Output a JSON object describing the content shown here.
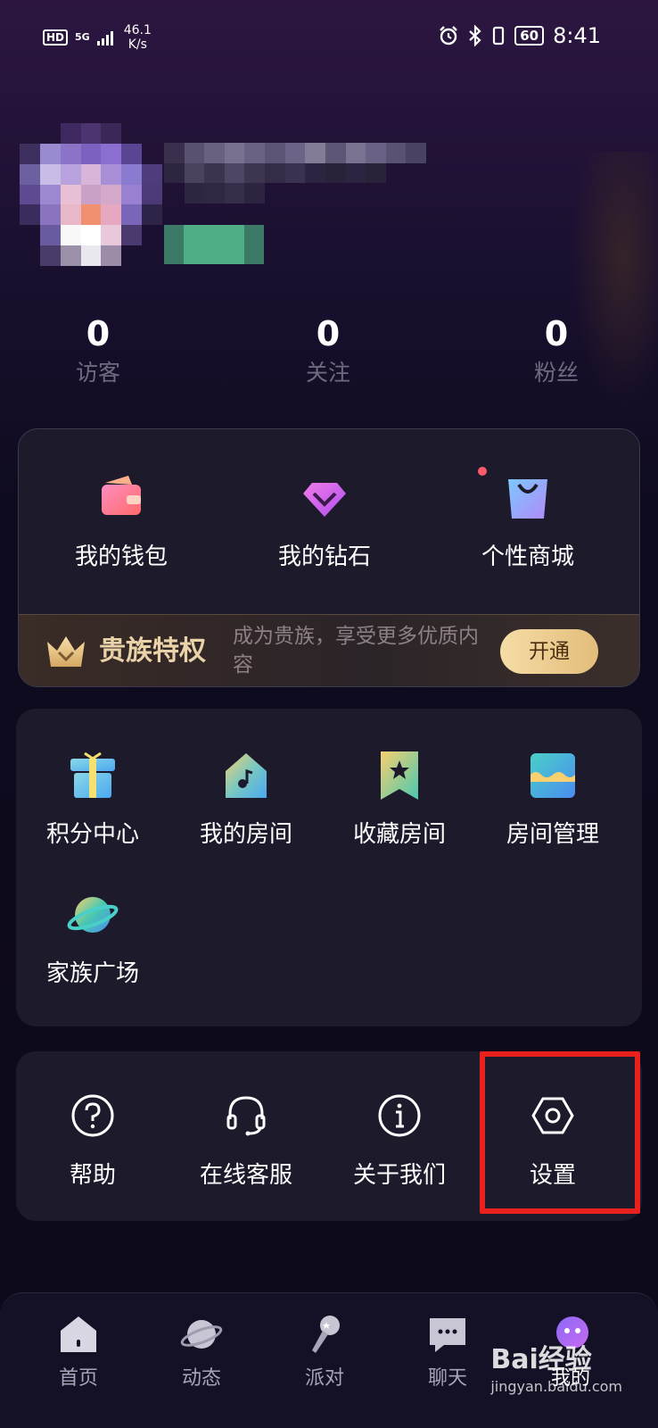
{
  "status_bar": {
    "hd": "HD",
    "net": "5G",
    "speed": "46.1",
    "speed_unit": "K/s",
    "battery": "60",
    "time": "8:41"
  },
  "stats": [
    {
      "value": "0",
      "label": "访客"
    },
    {
      "value": "0",
      "label": "关注"
    },
    {
      "value": "0",
      "label": "粉丝"
    }
  ],
  "quick_actions": [
    {
      "label": "我的钱包",
      "icon": "wallet-icon"
    },
    {
      "label": "我的钻石",
      "icon": "diamond-icon"
    },
    {
      "label": "个性商城",
      "icon": "shopping-bag-icon"
    }
  ],
  "noble": {
    "title": "贵族特权",
    "description": "成为贵族，享受更多优质内容",
    "button": "开通"
  },
  "features": [
    {
      "label": "积分中心",
      "icon": "gift-icon"
    },
    {
      "label": "我的房间",
      "icon": "music-house-icon"
    },
    {
      "label": "收藏房间",
      "icon": "bookmark-star-icon"
    },
    {
      "label": "房间管理",
      "icon": "store-icon"
    },
    {
      "label": "家族广场",
      "icon": "planet-icon"
    }
  ],
  "services": [
    {
      "label": "帮助",
      "icon": "help-icon"
    },
    {
      "label": "在线客服",
      "icon": "headset-icon"
    },
    {
      "label": "关于我们",
      "icon": "info-icon"
    },
    {
      "label": "设置",
      "icon": "settings-icon"
    }
  ],
  "bottom_nav": [
    {
      "label": "首页",
      "icon": "home-icon"
    },
    {
      "label": "动态",
      "icon": "planet-icon"
    },
    {
      "label": "派对",
      "icon": "microphone-icon"
    },
    {
      "label": "聊天",
      "icon": "chat-icon"
    },
    {
      "label": "我的",
      "icon": "profile-icon"
    }
  ],
  "watermark": {
    "brand": "Bai经验",
    "url": "jingyan.baidu.com"
  },
  "colors": {
    "background": "#0f0b1f",
    "card": "#1d1a2c",
    "highlight": "#e8201e",
    "noble_gold": "#ead3a8",
    "muted_text": "#6f6a80"
  }
}
